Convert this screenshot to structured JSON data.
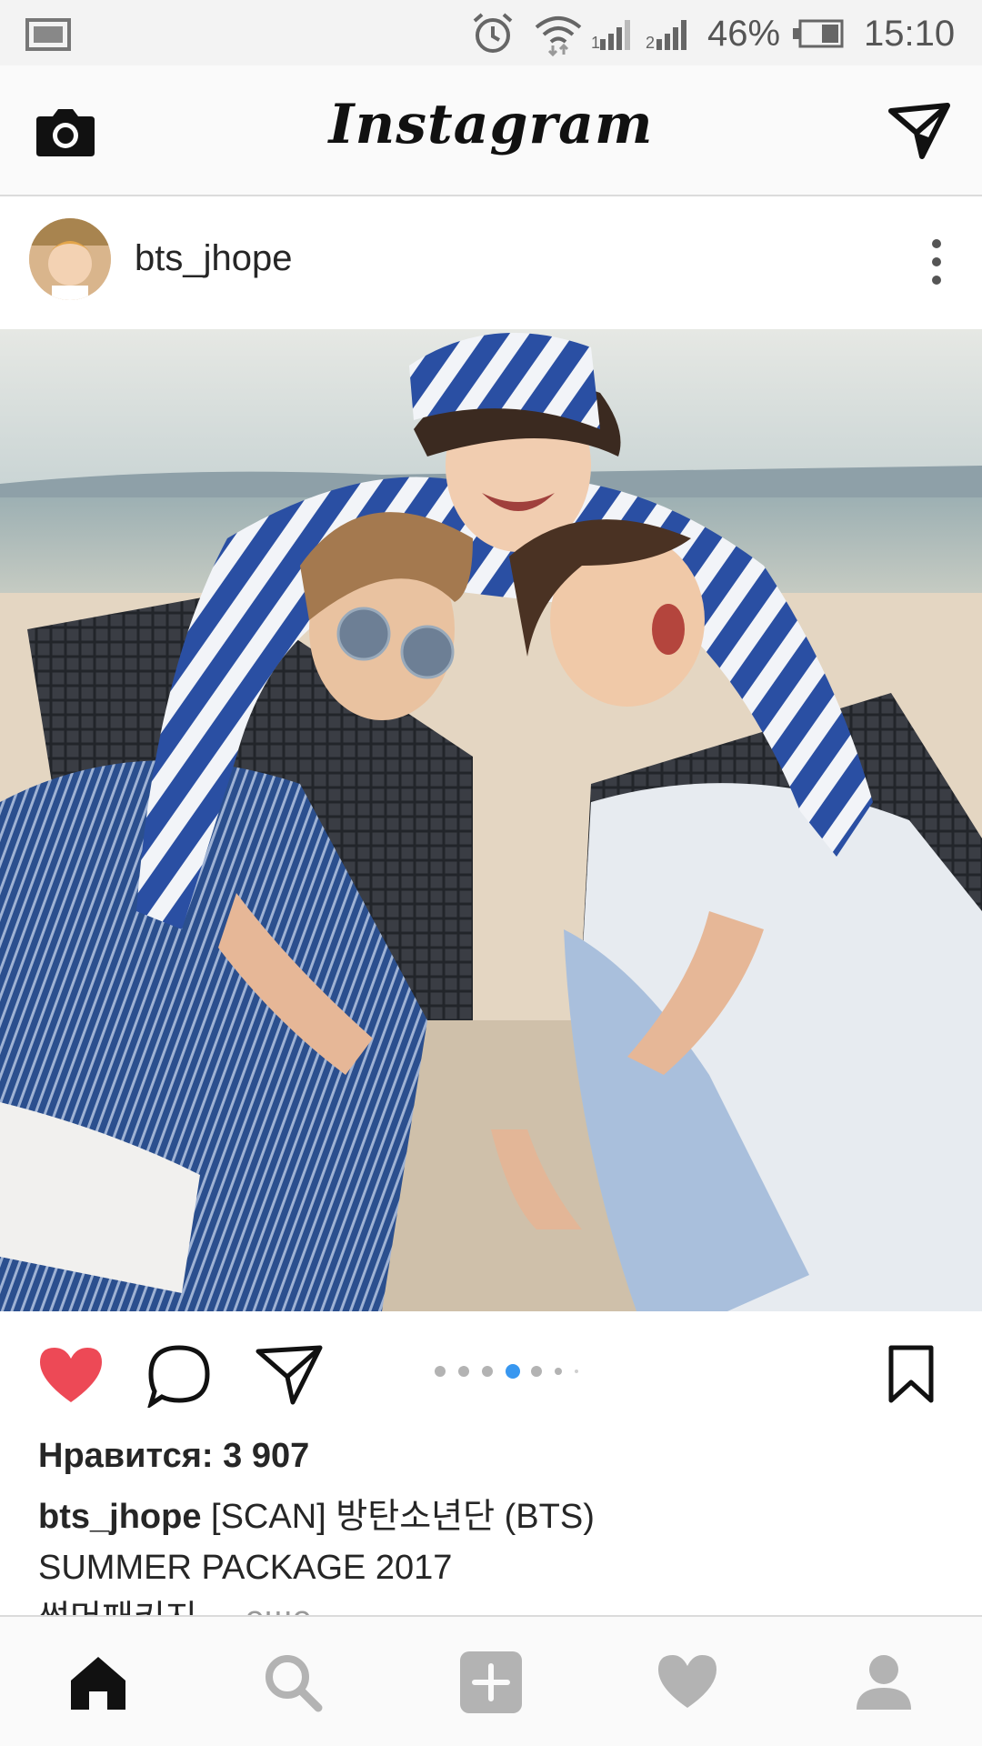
{
  "status_bar": {
    "battery": "46%",
    "time": "15:10",
    "icons": [
      "screenshot-icon",
      "alarm-icon",
      "wifi-icon",
      "signal-1-icon",
      "signal-2-icon",
      "battery-icon"
    ]
  },
  "app_bar": {
    "title": "Instagram",
    "left_icon": "camera-icon",
    "right_icon": "direct-message-icon"
  },
  "post": {
    "username": "bts_jhope",
    "likes_label": "Нравится: 3 907",
    "caption_user": "bts_jhope",
    "caption_line1": " [SCAN] 방탄소년단 (BTS)",
    "caption_line2": " SUMMER PACKAGE 2017",
    "caption_line3": "썸머패키지",
    "more_label": "... еще",
    "carousel": {
      "count": 7,
      "active_index": 3
    }
  },
  "bottom_nav": {
    "items": [
      "home-icon",
      "search-icon",
      "add-post-icon",
      "activity-heart-icon",
      "profile-icon"
    ]
  },
  "colors": {
    "like_red": "#ed4956",
    "carousel_active": "#3897f0",
    "nav_inactive": "#b3b3b3"
  }
}
